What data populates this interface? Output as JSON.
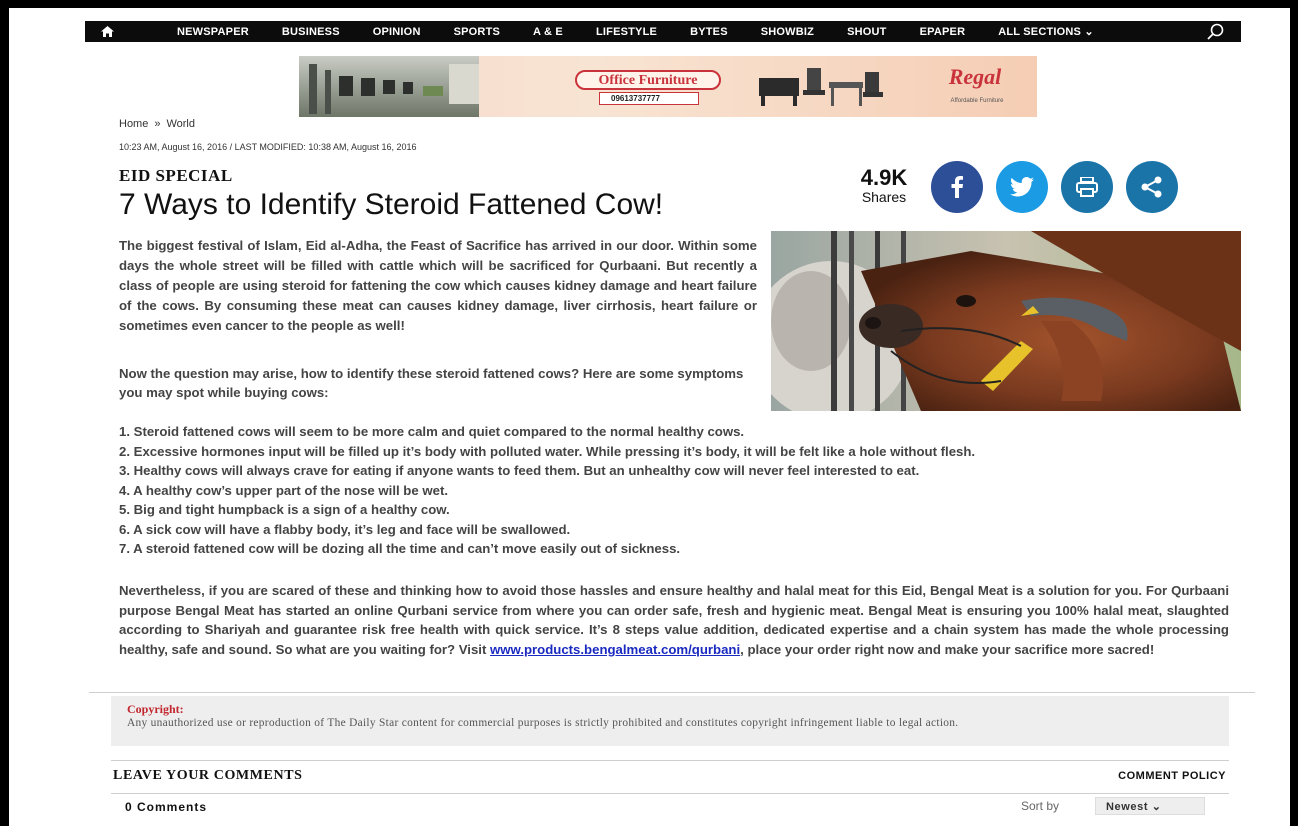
{
  "nav": {
    "items": [
      "NEWSPAPER",
      "BUSINESS",
      "OPINION",
      "SPORTS",
      "A & E",
      "LIFESTYLE",
      "BYTES",
      "SHOWBIZ",
      "SHOUT",
      "EPAPER",
      "ALL SECTIONS ⌄"
    ],
    "home_icon": "home-icon",
    "search_icon": "search-icon"
  },
  "ad": {
    "title": "Office Furniture",
    "phone": "09613737777",
    "brand": "Regal",
    "brand_sub": "Affordable Furniture"
  },
  "breadcrumb": {
    "home": "Home",
    "sep": "»",
    "section": "World"
  },
  "timestamp": "10:23 AM, August 16, 2016 / LAST MODIFIED: 10:38 AM, August 16, 2016",
  "article": {
    "kicker": "EID SPECIAL",
    "headline": "7 Ways to Identify Steroid Fattened Cow!",
    "lead": "The biggest festival of Islam, Eid al-Adha, the Feast of Sacrifice has arrived in our door. Within some days the whole street will be filled with cattle which will be sacrificed for Qurbaani. But recently a class of people are using steroid for fattening the cow which causes kidney damage and heart failure of the cows. By consuming these meat can causes kidney damage, liver cirrhosis, heart failure or sometimes even cancer to the people as well!",
    "question": "Now the question may arise, how to identify these steroid fattened cows? Here are some symptoms you may spot while buying cows:",
    "list": [
      "1. Steroid fattened cows will seem to be more calm and quiet compared to the normal healthy cows.",
      "2. Excessive hormones input will be filled up it’s body with polluted water. While pressing it’s body, it will be felt like a hole without flesh.",
      "3. Healthy cows will always crave for eating if anyone wants to feed them. But an unhealthy cow will never feel interested to eat.",
      "4. A healthy cow’s upper part of the nose will be wet.",
      "5. Big and tight humpback is a sign of a healthy cow.",
      "6. A sick cow will have a flabby body, it’s leg and face will be swallowed.",
      "7. A steroid fattened cow will be dozing all the time and can’t move easily out of sickness."
    ],
    "closing": "Nevertheless, if you are scared of these and thinking how to avoid those hassles and ensure healthy and halal meat for this Eid, Bengal Meat  is a solution for you. For Qurbaani purpose Bengal Meat has started an online Qurbani service from where you can order safe, fresh and hygienic meat. Bengal Meat is ensuring you 100% halal meat, slaughted according to Shariyah and guarantee risk free health with quick service. It’s 8 steps value addition, dedicated expertise and a chain system has made the whole processing healthy, safe and sound. So what are you waiting for? Visit ",
    "link": "www.products.bengalmeat.com/qurbani",
    "closing_end": ", place your order right now and make your sacrifice more sacred!"
  },
  "shares": {
    "count": "4.9K",
    "label": "Shares"
  },
  "copyright": {
    "title": "Copyright:",
    "text": "Any unauthorized use or reproduction of The Daily Star content for commercial purposes is strictly prohibited and constitutes copyright infringement liable to legal action."
  },
  "comments": {
    "title": "LEAVE YOUR COMMENTS",
    "policy": "COMMENT POLICY",
    "count": "0 Comments",
    "sort_label": "Sort by",
    "sort_value": "Newest ⌄"
  }
}
